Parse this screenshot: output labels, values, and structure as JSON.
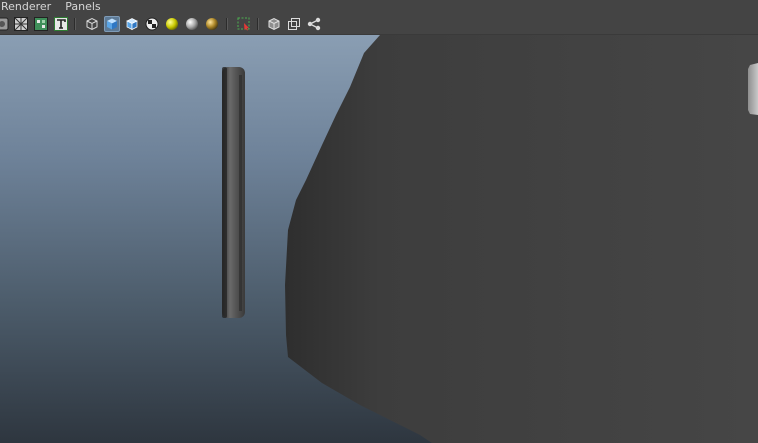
{
  "menubar": {
    "items": [
      "Renderer",
      "Panels"
    ]
  },
  "toolbar": {
    "buttons": [
      "camera-attributes-icon",
      "wireframe-grid-icon",
      "uv-texture-icon",
      "text-t-icon",
      "wireframe-cube-icon",
      "smooth-shade-cube-icon",
      "wireframe-on-shaded-cube-icon",
      "checker-texture-icon",
      "default-light-sphere-icon",
      "all-lights-sphere-icon",
      "shadow-sphere-icon",
      "select-region-icon",
      "isolate-select-cube-icon",
      "xray-cube-icon",
      "node-graph-icon"
    ],
    "active_button": "smooth-shade-cube-icon"
  },
  "viewport": {
    "background_top": "#8a9eb3",
    "background_bottom": "#2e363f",
    "objects": [
      "thin-disc-object",
      "large-dark-object",
      "small-light-object"
    ]
  }
}
